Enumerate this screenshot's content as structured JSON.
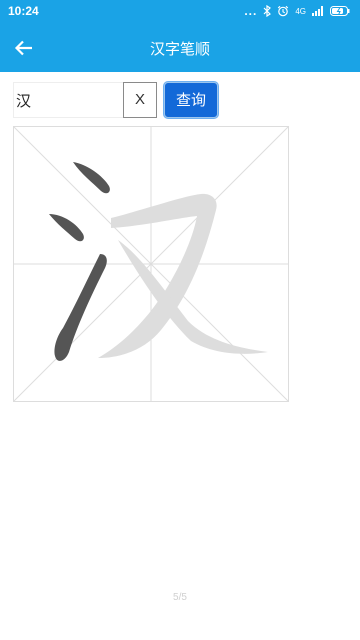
{
  "status_bar": {
    "time": "10:24",
    "dots": "...",
    "network": "4G"
  },
  "app_bar": {
    "title": "汉字笔顺",
    "back_icon": "arrow-left-icon"
  },
  "search": {
    "value": "汉",
    "clear_label": "X",
    "query_label": "查询"
  },
  "stroke_board": {
    "character": "汉",
    "current_stroke": 3,
    "total_strokes": 5,
    "colors": {
      "active_stroke": "#555555",
      "pending_stroke": "#dddddd",
      "grid": "#dddddd"
    }
  },
  "pager": {
    "text": "5/5"
  },
  "colors": {
    "brand": "#1aa3e6",
    "button": "#1369d8"
  }
}
